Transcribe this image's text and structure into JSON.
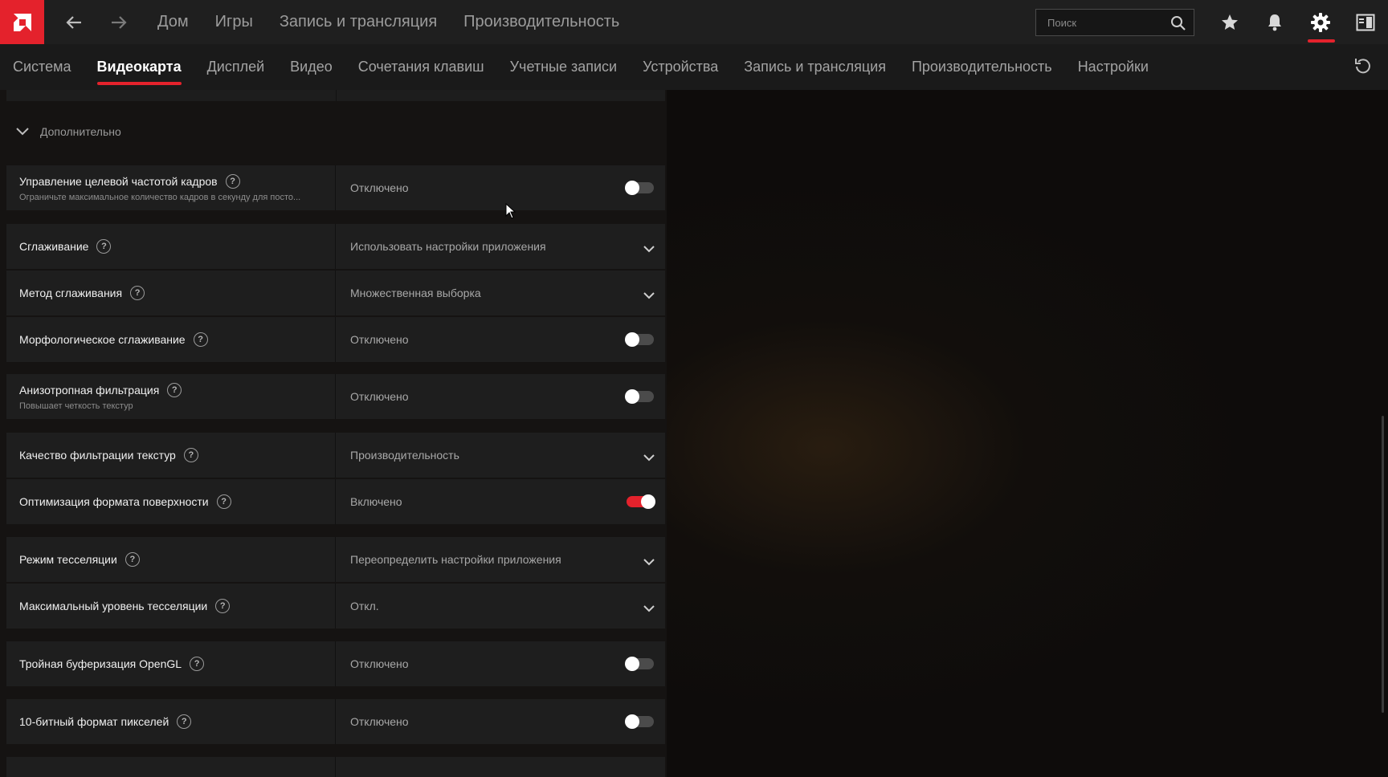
{
  "topbar": {
    "nav": [
      "Дом",
      "Игры",
      "Запись и трансляция",
      "Производительность"
    ],
    "search_placeholder": "Поиск"
  },
  "tabs": [
    "Система",
    "Видеокарта",
    "Дисплей",
    "Видео",
    "Сочетания клавиш",
    "Учетные записи",
    "Устройства",
    "Запись и трансляция",
    "Производительность",
    "Настройки"
  ],
  "active_tab": "Видеокарта",
  "section": {
    "title": "Дополнительно"
  },
  "settings": [
    {
      "label": "Управление целевой частотой кадров",
      "sub": "Ограничьте максимальное количество кадров в секунду для посто...",
      "value": "Отключено",
      "control": "toggle",
      "on": false
    },
    {
      "label": "Сглаживание",
      "value": "Использовать настройки приложения",
      "control": "dropdown"
    },
    {
      "label": "Метод сглаживания",
      "value": "Множественная выборка",
      "control": "dropdown"
    },
    {
      "label": "Морфологическое сглаживание",
      "value": "Отключено",
      "control": "toggle",
      "on": false
    },
    {
      "label": "Анизотропная фильтрация",
      "sub": "Повышает четкость текстур",
      "value": "Отключено",
      "control": "toggle",
      "on": false
    },
    {
      "label": "Качество фильтрации текстур",
      "value": "Производительность",
      "control": "dropdown"
    },
    {
      "label": "Оптимизация формата поверхности",
      "value": "Включено",
      "control": "toggle",
      "on": true
    },
    {
      "label": "Режим тесселяции",
      "value": "Переопределить настройки приложения",
      "control": "dropdown"
    },
    {
      "label": "Максимальный уровень тесселяции",
      "value": "Откл.",
      "control": "dropdown"
    },
    {
      "label": "Тройная буферизация OpenGL",
      "value": "Отключено",
      "control": "toggle",
      "on": false
    },
    {
      "label": "10-битный формат пикселей",
      "value": "Отключено",
      "control": "toggle",
      "on": false
    }
  ],
  "colors": {
    "accent": "#e4222c",
    "row_bg": "#1e1e1e",
    "topbar_bg": "#1f1f1f"
  },
  "icons": [
    "amd-logo-icon",
    "back-arrow-icon",
    "forward-arrow-icon",
    "search-icon",
    "star-icon",
    "bell-icon",
    "gear-icon",
    "sidebar-panel-icon",
    "reset-icon",
    "chevron-down-icon",
    "help-icon"
  ]
}
